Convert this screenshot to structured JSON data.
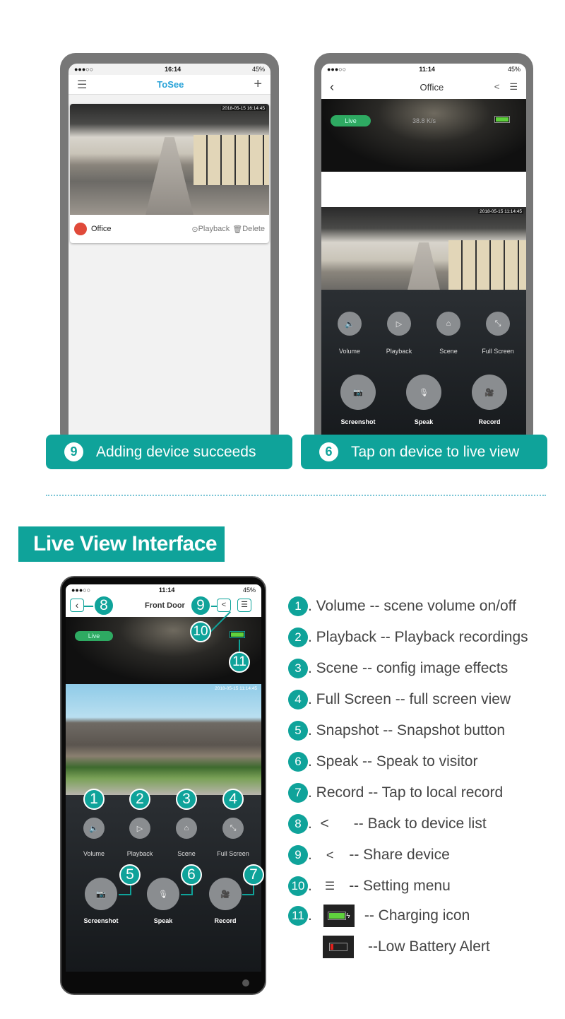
{
  "colors": {
    "accent": "#0fa39a",
    "live": "#2eaa62",
    "battery_full": "#5fd13d",
    "battery_low": "#e0201c"
  },
  "phone1": {
    "status": {
      "signal": "●●●○○",
      "time": "16:14",
      "battery": "45%"
    },
    "nav": {
      "menu_icon": "hamburger-icon",
      "title": "ToSee",
      "add_icon": "plus-icon"
    },
    "card": {
      "timestamp": "2018-05-15 16:14:45",
      "name": "Office",
      "playback": "Playback",
      "delete": "Delete"
    }
  },
  "phone2": {
    "status": {
      "signal": "●●●○○",
      "time": "11:14",
      "battery": "45%"
    },
    "nav": {
      "title": "Office"
    },
    "live": "Live",
    "speed": "38.8 K/s",
    "timestamp": "2018-05-15 11:14:45",
    "controls": [
      "Volume",
      "Playback",
      "Scene",
      "Full Screen"
    ],
    "big_controls": [
      "Screenshot",
      "Speak",
      "Record"
    ]
  },
  "banners": [
    {
      "num": "9",
      "text": "Adding device succeeds"
    },
    {
      "num": "6",
      "text": "Tap on device to live view"
    }
  ],
  "section_title": "Live View Interface",
  "phone3": {
    "status": {
      "signal": "●●●○○",
      "time": "11:14",
      "battery": "45%"
    },
    "nav": {
      "title": "Front Door"
    },
    "live": "Live",
    "timestamp": "2018-05-15 11:14:45",
    "controls": [
      "Volume",
      "Playback",
      "Scene",
      "Full Screen"
    ],
    "big_controls": [
      "Screenshot",
      "Speak",
      "Record"
    ],
    "badges": [
      "1",
      "2",
      "3",
      "4",
      "5",
      "6",
      "7",
      "8",
      "9",
      "10",
      "11"
    ]
  },
  "legend": [
    {
      "n": "1",
      "text": ". Volume -- scene volume on/off"
    },
    {
      "n": "2",
      "text": ". Playback -- Playback recordings"
    },
    {
      "n": "3",
      "text": ". Scene -- config image effects"
    },
    {
      "n": "4",
      "text": ". Full Screen -- full screen view"
    },
    {
      "n": "5",
      "text": ". Snapshot -- Snapshot button"
    },
    {
      "n": "6",
      "text": ". Speak -- Speak to visitor"
    },
    {
      "n": "7",
      "text": ". Record -- Tap to local record"
    },
    {
      "n": "8",
      "text": ".  <      -- Back to device list"
    },
    {
      "n": "9",
      "text": ".",
      "after": "-- Share device"
    },
    {
      "n": "10",
      "text": ".",
      "after": "-- Setting menu"
    },
    {
      "n": "11",
      "text": ".",
      "after": "-- Charging icon"
    },
    {
      "after": "--Low Battery Alert"
    }
  ]
}
